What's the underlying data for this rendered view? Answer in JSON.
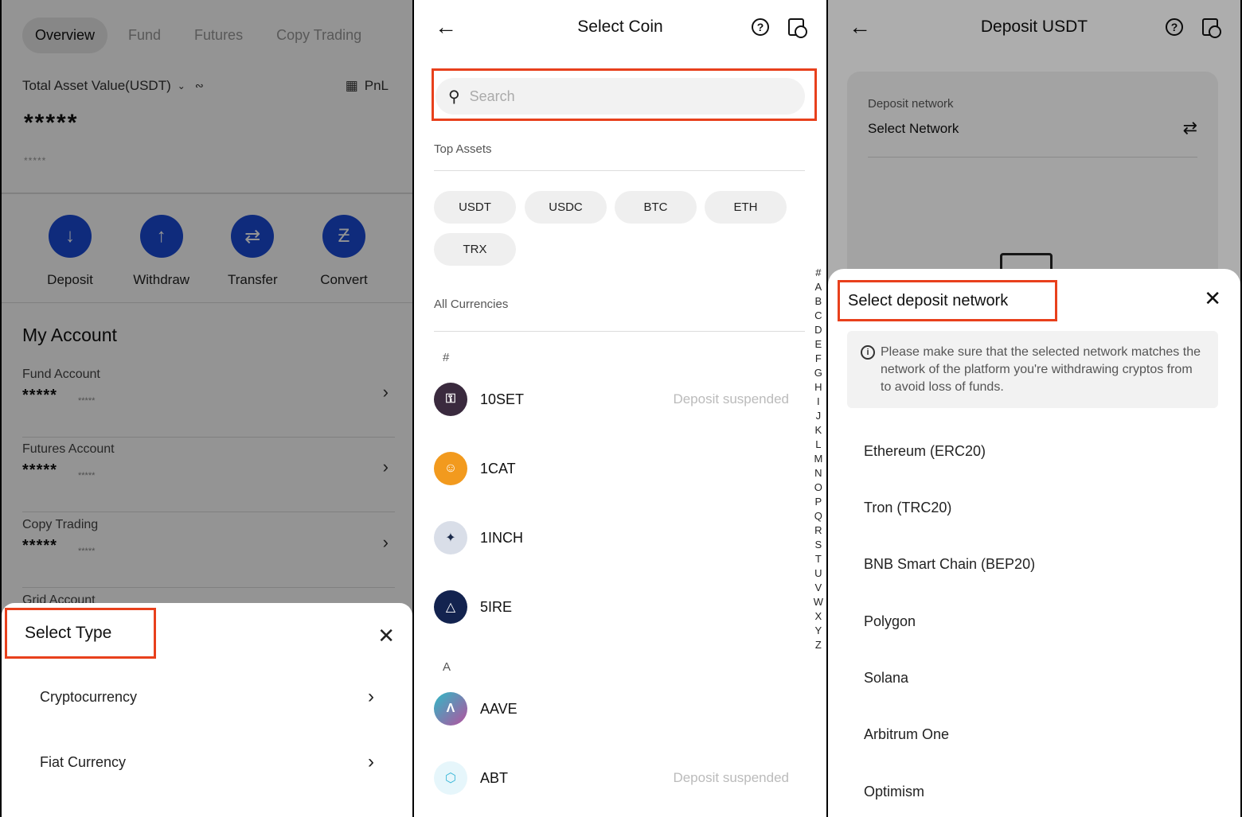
{
  "panel1": {
    "tabs": [
      "Overview",
      "Fund",
      "Futures",
      "Copy Trading"
    ],
    "total_label": "Total Asset Value(USDT)",
    "pnl_label": "PnL",
    "total_mask": "*****",
    "total_sub_mask": "*****",
    "actions": [
      "Deposit",
      "Withdraw",
      "Transfer",
      "Convert"
    ],
    "my_account": "My Account",
    "accounts": [
      {
        "name": "Fund Account",
        "mask": "*****",
        "sub": "*****"
      },
      {
        "name": "Futures Account",
        "mask": "*****",
        "sub": "*****"
      },
      {
        "name": "Copy Trading",
        "mask": "*****",
        "sub": "*****"
      },
      {
        "name": "Grid Account"
      }
    ],
    "sheet": {
      "title": "Select Type",
      "options": [
        "Cryptocurrency",
        "Fiat Currency"
      ]
    }
  },
  "panel2": {
    "title": "Select Coin",
    "search_placeholder": "Search",
    "top_assets_label": "Top Assets",
    "top_assets": [
      "USDT",
      "USDC",
      "BTC",
      "ETH",
      "TRX"
    ],
    "all_label": "All Currencies",
    "groups": [
      {
        "letter": "#",
        "coins": [
          {
            "name": "10SET",
            "status": "Deposit suspended"
          },
          {
            "name": "1CAT",
            "status": ""
          },
          {
            "name": "1INCH",
            "status": ""
          },
          {
            "name": "5IRE",
            "status": ""
          }
        ]
      },
      {
        "letter": "A",
        "coins": [
          {
            "name": "AAVE",
            "status": ""
          },
          {
            "name": "ABT",
            "status": "Deposit suspended"
          }
        ]
      }
    ],
    "index": [
      "#",
      "A",
      "B",
      "C",
      "D",
      "E",
      "F",
      "G",
      "H",
      "I",
      "J",
      "K",
      "L",
      "M",
      "N",
      "O",
      "P",
      "Q",
      "R",
      "S",
      "T",
      "U",
      "V",
      "W",
      "X",
      "Y",
      "Z"
    ]
  },
  "panel3": {
    "title": "Deposit USDT",
    "network_label": "Deposit network",
    "network_value": "Select Network",
    "sheet": {
      "title": "Select deposit network",
      "notice": "Please make sure that the selected network matches the network of the platform you're withdrawing cryptos from to avoid loss of funds.",
      "networks": [
        "Ethereum (ERC20)",
        "Tron (TRC20)",
        "BNB Smart Chain (BEP20)",
        "Polygon",
        "Solana",
        "Arbitrum One",
        "Optimism"
      ]
    }
  }
}
